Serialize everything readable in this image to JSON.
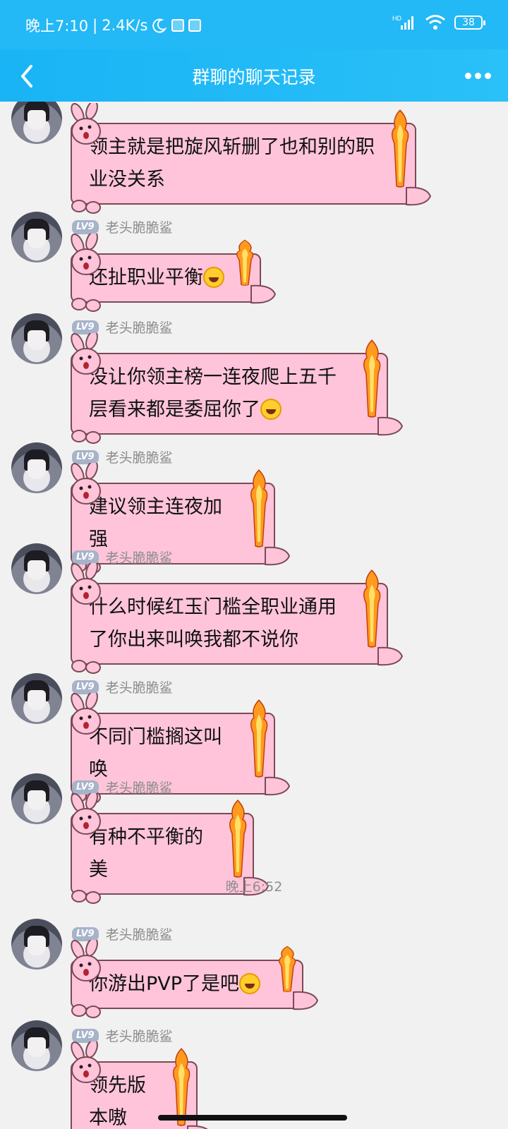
{
  "status_bar": {
    "time": "晚上7:10",
    "speed": "2.4K/s",
    "battery": "38",
    "network": "HD"
  },
  "header": {
    "title": "群聊的聊天记录"
  },
  "colors": {
    "header": "#23b8f6",
    "bubble": "#ffc4da",
    "background": "#f1f1f1"
  },
  "messages": [
    {
      "level": "",
      "name": "",
      "text": "领主就是把旋风斩删了也和别的职业没关系"
    },
    {
      "level": "LV9",
      "name": "老头脆脆鲨",
      "text": "还扯职业平衡",
      "emoji": "rofl-emoji"
    },
    {
      "level": "LV9",
      "name": "老头脆脆鲨",
      "text": "没让你领主榜一连夜爬上五千层看来都是委屈你了",
      "emoji": "rofl-emoji"
    },
    {
      "level": "LV9",
      "name": "老头脆脆鲨",
      "text": "建议领主连夜加强"
    },
    {
      "level": "LV9",
      "name": "老头脆脆鲨",
      "text": "什么时候红玉门槛全职业通用了你出来叫唤我都不说你"
    },
    {
      "level": "LV9",
      "name": "老头脆脆鲨",
      "text": "不同门槛搁这叫唤"
    },
    {
      "level": "LV9",
      "name": "老头脆脆鲨",
      "text": "有种不平衡的美"
    },
    {
      "level": "LV9",
      "name": "老头脆脆鲨",
      "text": "你游出PVP了是吧",
      "emoji": "rofl-emoji"
    },
    {
      "level": "LV9",
      "name": "老头脆脆鲨",
      "text": "领先版本嗷"
    }
  ],
  "timestamp": "晚上6:52"
}
